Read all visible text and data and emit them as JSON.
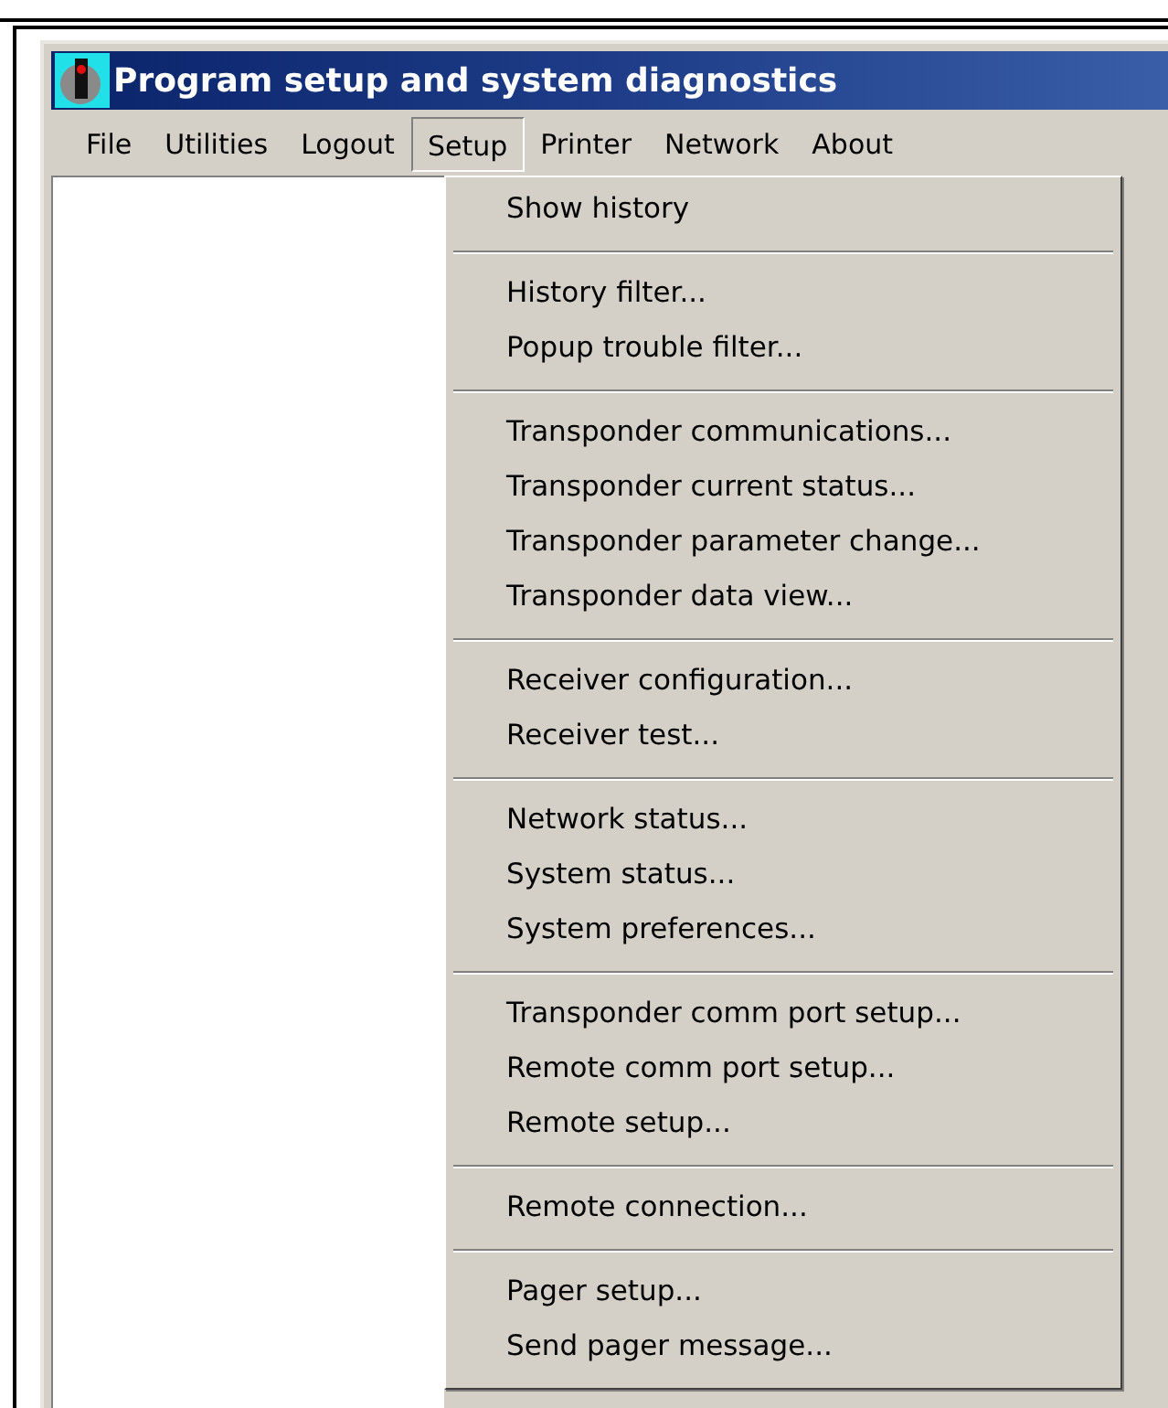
{
  "window": {
    "title": "Program setup and system diagnostics"
  },
  "menu_bar": [
    {
      "label": "File",
      "selected": false
    },
    {
      "label": "Utilities",
      "selected": false
    },
    {
      "label": "Logout",
      "selected": false
    },
    {
      "label": "Setup",
      "selected": true
    },
    {
      "label": "Printer",
      "selected": false
    },
    {
      "label": "Network",
      "selected": false
    },
    {
      "label": "About",
      "selected": false
    }
  ],
  "dropdown": {
    "groups": [
      [
        "Show history"
      ],
      [
        "History filter...",
        "Popup trouble filter..."
      ],
      [
        "Transponder communications...",
        "Transponder current status...",
        "Transponder parameter change...",
        "Transponder data view..."
      ],
      [
        "Receiver configuration...",
        "Receiver test..."
      ],
      [
        "Network status...",
        "System status...",
        "System preferences..."
      ],
      [
        "Transponder comm port setup...",
        "Remote comm port setup...",
        "Remote setup..."
      ],
      [
        "Remote connection..."
      ],
      [
        "Pager setup...",
        "Send pager message..."
      ]
    ]
  }
}
